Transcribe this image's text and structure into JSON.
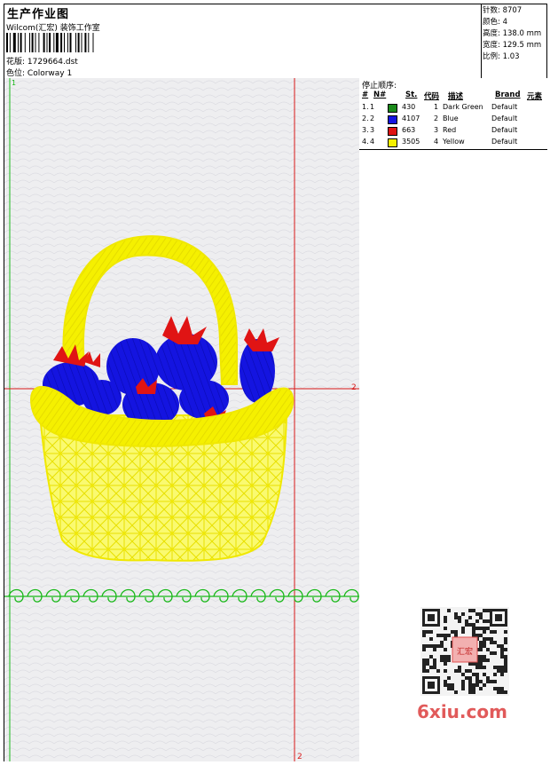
{
  "header": {
    "title": "生产作业图",
    "company": "Wilcom(汇宏) 装饰工作室",
    "design_label": "花版:",
    "design_value": "1729664.dst",
    "colorway_label": "色位:",
    "colorway_value": "Colorway 1"
  },
  "stats": {
    "stitches_label": "针数:",
    "stitches_value": "8707",
    "colors_label": "颜色:",
    "colors_value": "4",
    "height_label": "高度:",
    "height_value": "138.0 mm",
    "width_label": "宽度:",
    "width_value": "129.5 mm",
    "scale_label": "比例:",
    "scale_value": "1.03"
  },
  "stop_sequence": {
    "title": "停止顺序:",
    "columns": [
      "#",
      "N#",
      "St.",
      "代码",
      "描述",
      "Brand",
      "元素"
    ],
    "rows": [
      {
        "num": "1.",
        "n": "1",
        "color": "#1a8a1a",
        "st": "430",
        "code": "1",
        "desc": "Dark Green",
        "brand": "Default"
      },
      {
        "num": "2.",
        "n": "2",
        "color": "#1414e0",
        "st": "4107",
        "code": "2",
        "desc": "Blue",
        "brand": "Default"
      },
      {
        "num": "3.",
        "n": "3",
        "color": "#e01414",
        "st": "663",
        "code": "3",
        "desc": "Red",
        "brand": "Default"
      },
      {
        "num": "4.",
        "n": "4",
        "color": "#f5f000",
        "st": "3505",
        "code": "4",
        "desc": "Yellow",
        "brand": "Default"
      }
    ]
  },
  "canvas": {
    "marker_1": "1",
    "marker_2": "2",
    "marker_2b": "2"
  },
  "watermark": {
    "logo_text": "6xiu.com",
    "stamp_text": "汇宏"
  },
  "colors": {
    "green": "#1a8a1a",
    "blue": "#1414e0",
    "red": "#e01414",
    "yellow": "#f5f000",
    "guide_red": "#d81818",
    "guide_green": "#18b818"
  }
}
